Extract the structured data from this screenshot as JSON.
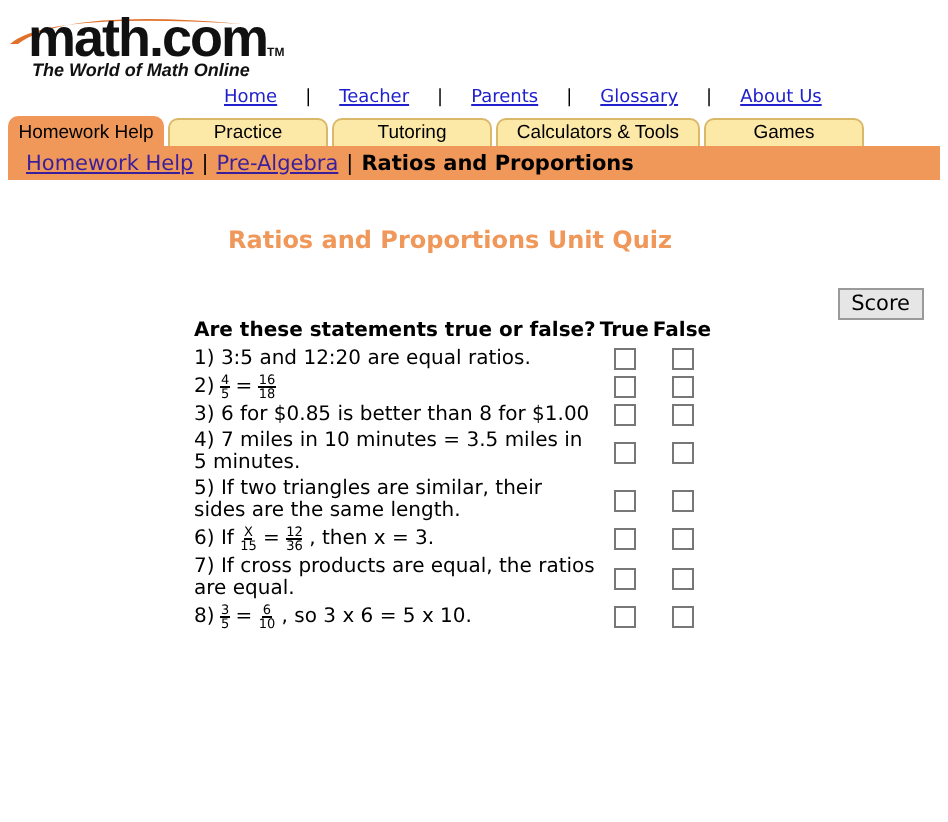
{
  "logo": {
    "name": "math.com",
    "mark": "TM",
    "tagline": "The World of Math Online"
  },
  "nav_links": [
    "Home",
    "Teacher",
    "Parents",
    "Glossary",
    "About Us"
  ],
  "nav_separator": "|",
  "tabs": [
    {
      "label": "Homework Help",
      "selected": true
    },
    {
      "label": "Practice",
      "selected": false
    },
    {
      "label": "Tutoring",
      "selected": false
    },
    {
      "label": "Calculators & Tools",
      "selected": false
    },
    {
      "label": "Games",
      "selected": false
    }
  ],
  "breadcrumb": {
    "links": [
      "Homework Help",
      "Pre-Algebra"
    ],
    "separator": "|",
    "current": "Ratios and Proportions"
  },
  "title": "Ratios and Proportions Unit Quiz",
  "score_button": "Score",
  "quiz": {
    "columns": [
      "Are these statements true or false?",
      "True",
      "False"
    ],
    "questions": [
      {
        "parts": [
          {
            "kind": "text",
            "text": "1) 3:5 and 12:20 are equal ratios."
          }
        ],
        "true_checked": false,
        "false_checked": false
      },
      {
        "parts": [
          {
            "kind": "text",
            "text": "2) "
          },
          {
            "kind": "fraction",
            "num": "4",
            "den": "5"
          },
          {
            "kind": "text",
            "text": " = "
          },
          {
            "kind": "fraction",
            "num": "16",
            "den": "18"
          }
        ],
        "true_checked": false,
        "false_checked": false
      },
      {
        "parts": [
          {
            "kind": "text",
            "text": "3) 6 for $0.85 is better than 8 for $1.00"
          }
        ],
        "true_checked": false,
        "false_checked": false
      },
      {
        "parts": [
          {
            "kind": "text",
            "text": "4) 7 miles in 10 minutes = 3.5 miles in 5 minutes."
          }
        ],
        "true_checked": false,
        "false_checked": false
      },
      {
        "parts": [
          {
            "kind": "text",
            "text": "5) If two triangles are similar, their sides are the same length."
          }
        ],
        "true_checked": false,
        "false_checked": false
      },
      {
        "parts": [
          {
            "kind": "text",
            "text": "6) If "
          },
          {
            "kind": "fraction",
            "num": "X",
            "den": "15"
          },
          {
            "kind": "text",
            "text": " = "
          },
          {
            "kind": "fraction",
            "num": "12",
            "den": "36"
          },
          {
            "kind": "text",
            "text": " , then x = 3."
          }
        ],
        "true_checked": false,
        "false_checked": false
      },
      {
        "parts": [
          {
            "kind": "text",
            "text": "7) If cross products are equal, the ratios are equal."
          }
        ],
        "true_checked": false,
        "false_checked": false
      },
      {
        "parts": [
          {
            "kind": "text",
            "text": "8) "
          },
          {
            "kind": "fraction",
            "num": "3",
            "den": "5"
          },
          {
            "kind": "text",
            "text": " = "
          },
          {
            "kind": "fraction",
            "num": "6",
            "den": "10"
          },
          {
            "kind": "text",
            "text": " , so 3 x 6 = 5 x 10."
          }
        ],
        "true_checked": false,
        "false_checked": false
      }
    ]
  }
}
